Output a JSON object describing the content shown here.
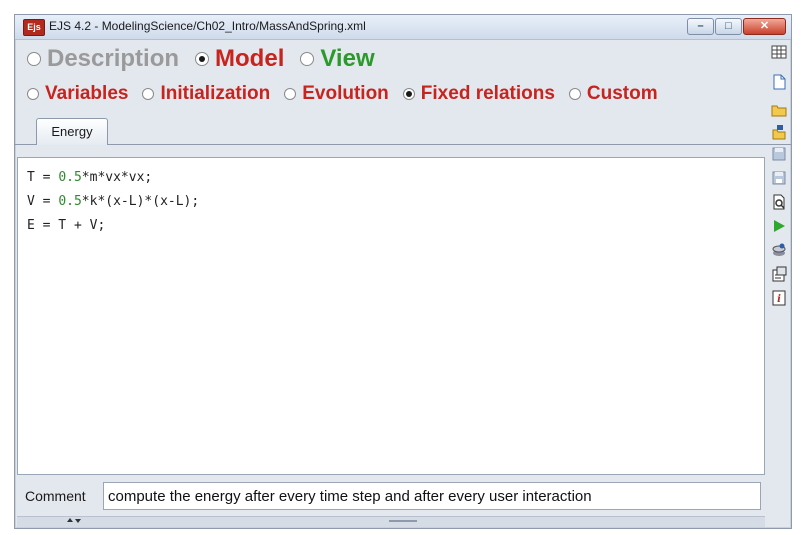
{
  "window": {
    "app_icon": "Ejs",
    "title": "EJS 4.2 - ModelingScience/Ch02_Intro/MassAndSpring.xml",
    "controls": {
      "minimize": "–",
      "maximize": "□",
      "close": "✕"
    }
  },
  "main_tabs": [
    {
      "label": "Description",
      "selected": false,
      "color": "#9a9a9a"
    },
    {
      "label": "Model",
      "selected": true,
      "color": "#c8241e"
    },
    {
      "label": "View",
      "selected": false,
      "color": "#2a9a2a"
    }
  ],
  "model_tabs": [
    {
      "label": "Variables",
      "selected": false
    },
    {
      "label": "Initialization",
      "selected": false
    },
    {
      "label": "Evolution",
      "selected": false
    },
    {
      "label": "Fixed relations",
      "selected": true
    },
    {
      "label": "Custom",
      "selected": false
    }
  ],
  "model_tab_color": "#c8241e",
  "page_tab": {
    "label": "Energy"
  },
  "code": [
    {
      "parts": [
        {
          "t": "T = ",
          "c": "text"
        },
        {
          "t": "0.5",
          "c": "num"
        },
        {
          "t": "*m*vx*vx;",
          "c": "text"
        }
      ]
    },
    {
      "parts": [
        {
          "t": "V = ",
          "c": "text"
        },
        {
          "t": "0.5",
          "c": "num"
        },
        {
          "t": "*k*(x-L)*(x-L);",
          "c": "text"
        }
      ]
    },
    {
      "parts": [
        {
          "t": "E = T + V;",
          "c": "text"
        }
      ]
    }
  ],
  "comment": {
    "label": "Comment",
    "value": "compute the energy after every time step and after every user interaction"
  },
  "toolbar_icons": [
    "table-icon",
    "new-file-icon",
    "open-folder-icon",
    "open-worldwide-icon",
    "save-icon",
    "save-as-icon",
    "search-icon",
    "run-icon",
    "package-icon",
    "options-icon",
    "info-icon"
  ]
}
